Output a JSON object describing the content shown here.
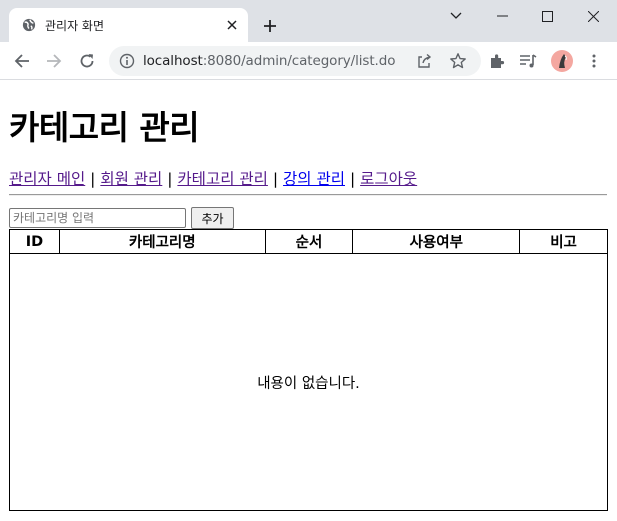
{
  "browser": {
    "tab_title": "관리자 화면",
    "url_host": "localhost",
    "url_path": ":8080/admin/category/list.do"
  },
  "page": {
    "title": "카테고리 관리",
    "nav": [
      {
        "label": "관리자 메인"
      },
      {
        "label": "회원 관리"
      },
      {
        "label": "카테고리 관리"
      },
      {
        "label": "강의 관리"
      },
      {
        "label": "로그아웃"
      }
    ],
    "nav_separator": "|",
    "form": {
      "input_placeholder": "카테고리명 입력",
      "input_value": "",
      "add_button_label": "추가"
    },
    "table": {
      "columns": [
        "ID",
        "카테고리명",
        "순서",
        "사용여부",
        "비고"
      ],
      "empty_message": "내용이 없습니다."
    }
  }
}
